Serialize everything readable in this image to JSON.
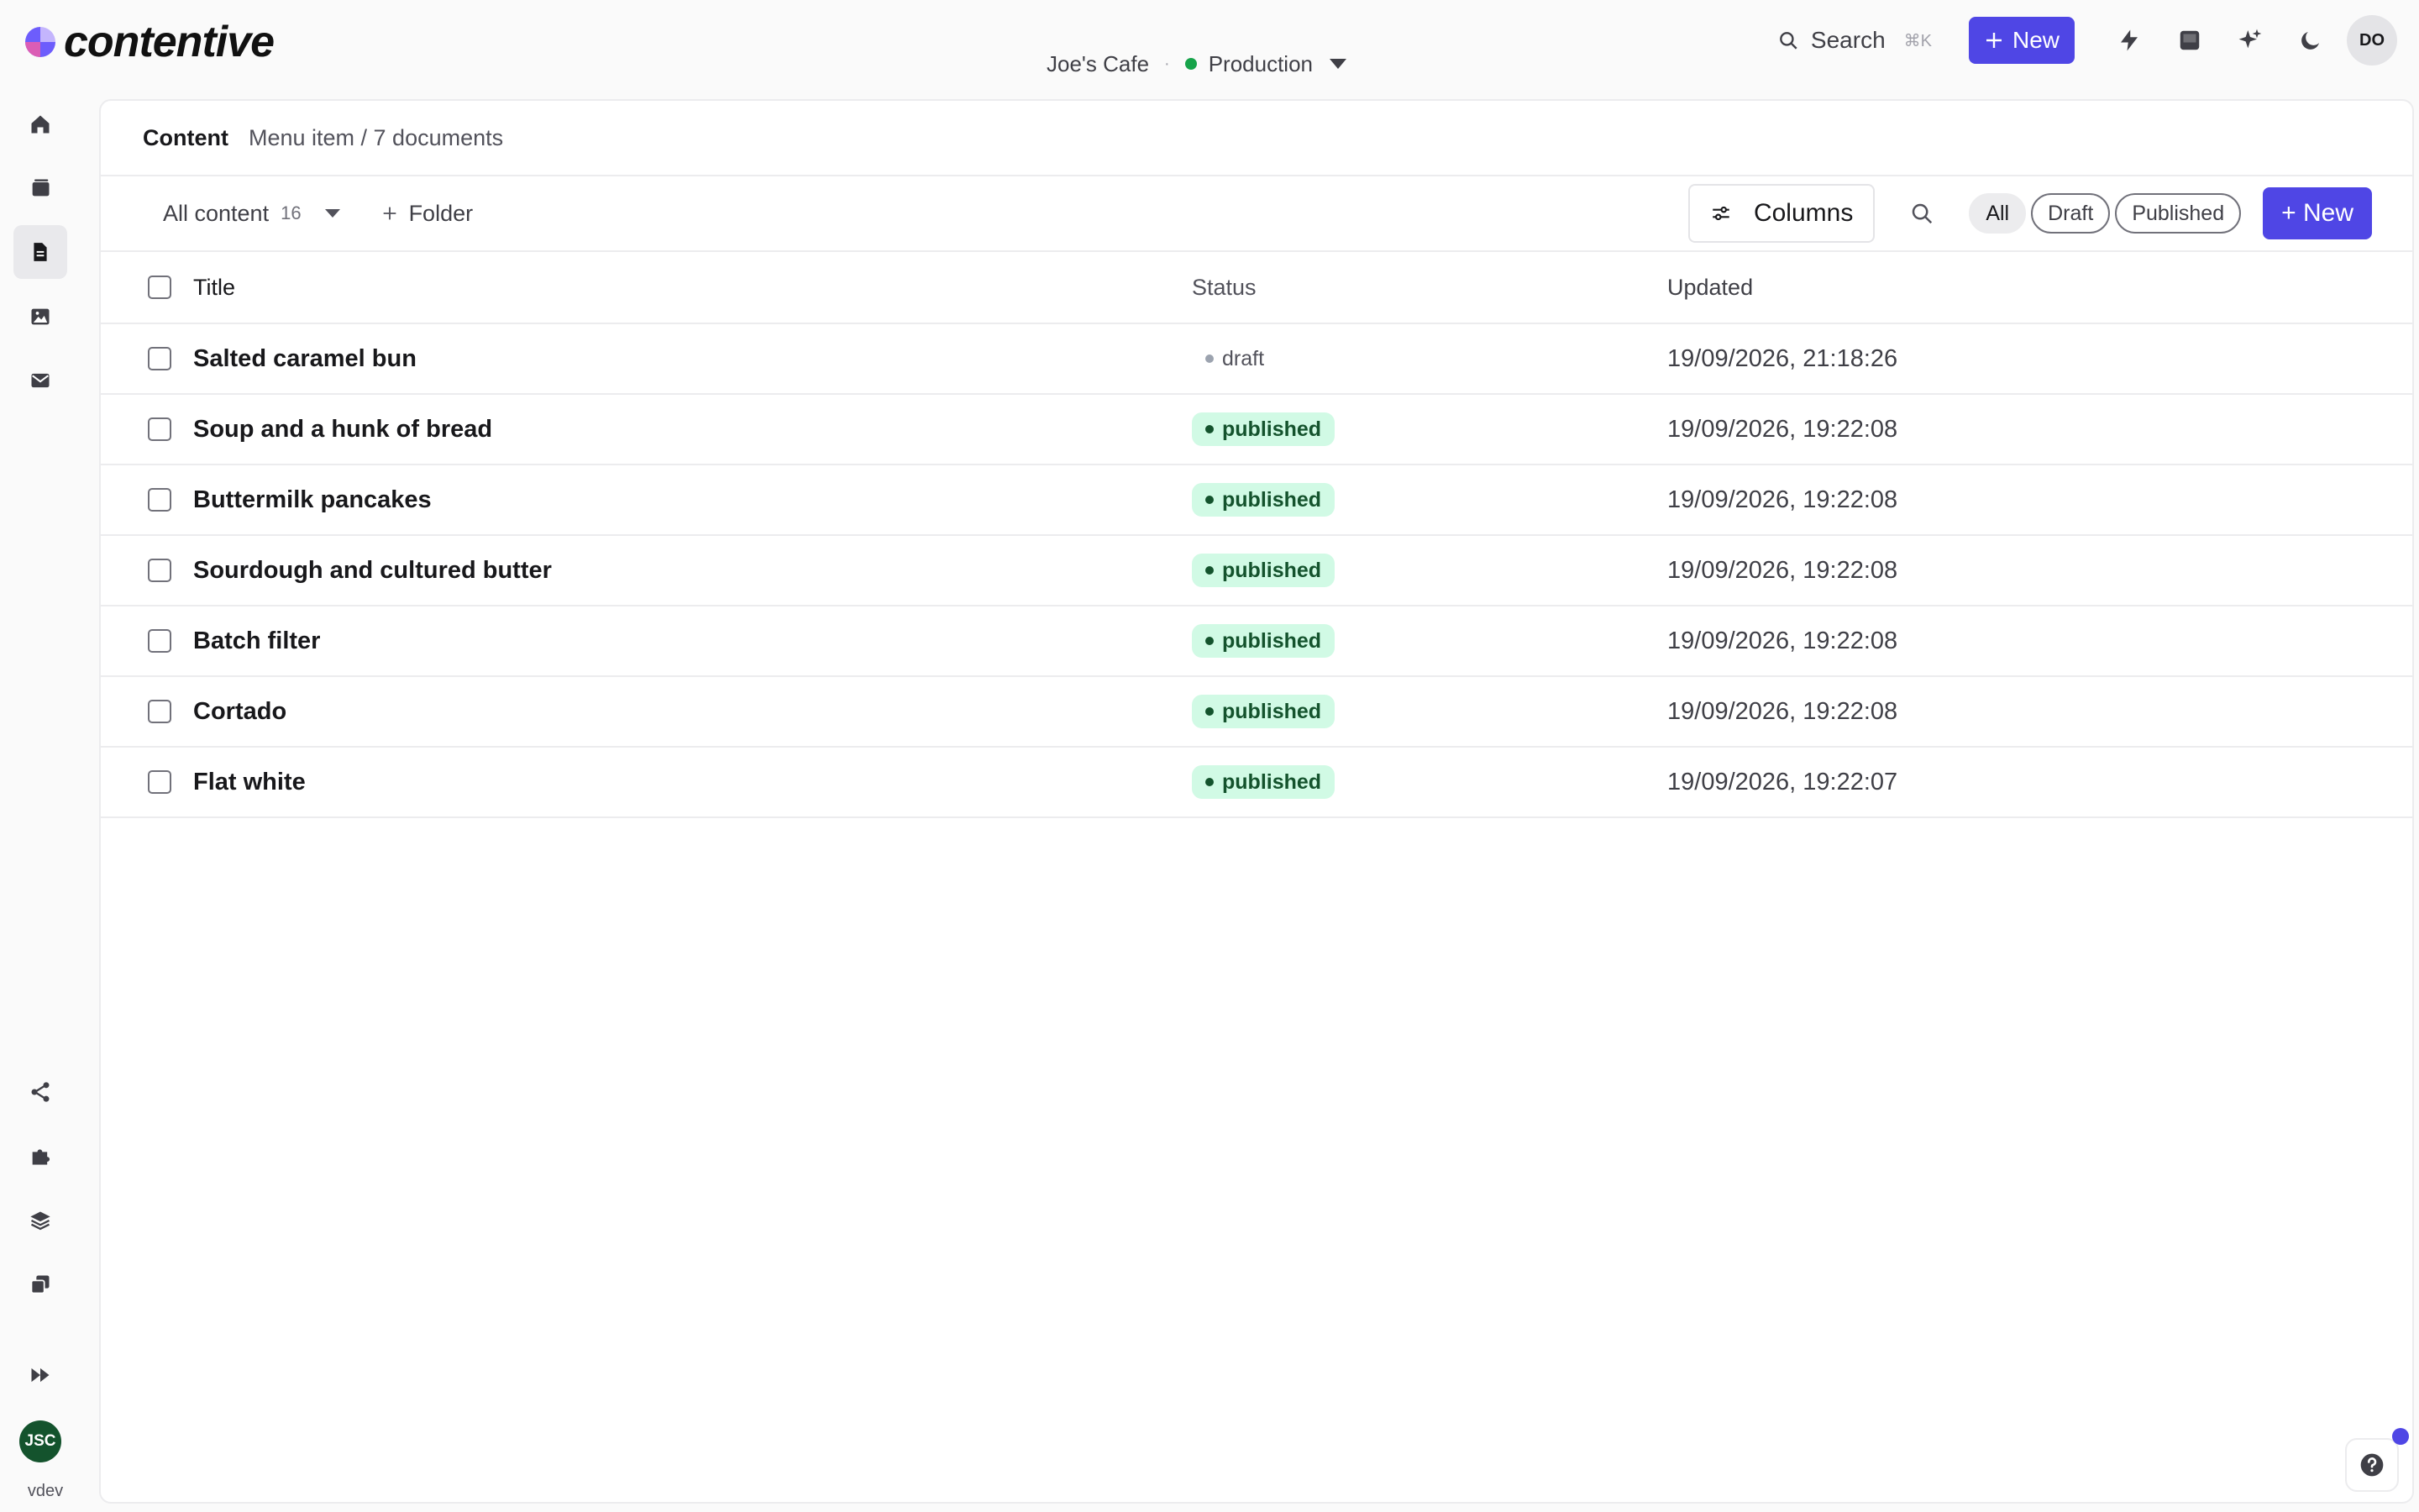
{
  "app": {
    "name": "contentive"
  },
  "header": {
    "project": "Joe's Cafe",
    "separator": "·",
    "environment": "Production",
    "search_label": "Search",
    "search_shortcut": "⌘K",
    "new_label": "New",
    "user_initials": "DO",
    "icons": [
      "lightning-icon",
      "inbox-icon",
      "sparkles-icon",
      "moon-icon"
    ]
  },
  "rail": {
    "items": [
      "home-icon",
      "cards-icon",
      "document-icon",
      "image-icon",
      "mail-icon"
    ],
    "bottom_items": [
      "share-icon",
      "puzzle-icon",
      "layers-icon",
      "copy-icon",
      "fast-forward-icon"
    ],
    "user_initials": "JSC",
    "env_label": "vdev"
  },
  "breadcrumb": {
    "section": "Content",
    "path": "Menu item / 7 documents"
  },
  "toolbar": {
    "folder_label": "All content",
    "folder_count": "16",
    "add_folder_label": "Folder",
    "columns_label": "Columns",
    "filters": [
      "All",
      "Draft",
      "Published"
    ],
    "active_filter": "All",
    "new_label": "+ New"
  },
  "table": {
    "columns": [
      "Title",
      "Status",
      "Updated"
    ],
    "rows": [
      {
        "title": "Salted caramel bun",
        "status": "draft",
        "updated": "19/09/2026, 21:18:26"
      },
      {
        "title": "Soup and a hunk of bread",
        "status": "published",
        "updated": "19/09/2026, 19:22:08"
      },
      {
        "title": "Buttermilk pancakes",
        "status": "published",
        "updated": "19/09/2026, 19:22:08"
      },
      {
        "title": "Sourdough and cultured butter",
        "status": "published",
        "updated": "19/09/2026, 19:22:08"
      },
      {
        "title": "Batch filter",
        "status": "published",
        "updated": "19/09/2026, 19:22:08"
      },
      {
        "title": "Cortado",
        "status": "published",
        "updated": "19/09/2026, 19:22:08"
      },
      {
        "title": "Flat white",
        "status": "published",
        "updated": "19/09/2026, 19:22:07"
      }
    ]
  },
  "colors": {
    "accent": "#4f46e5",
    "published_bg": "#d1fae5",
    "published_fg": "#14532d",
    "env_dot": "#16a34a"
  }
}
